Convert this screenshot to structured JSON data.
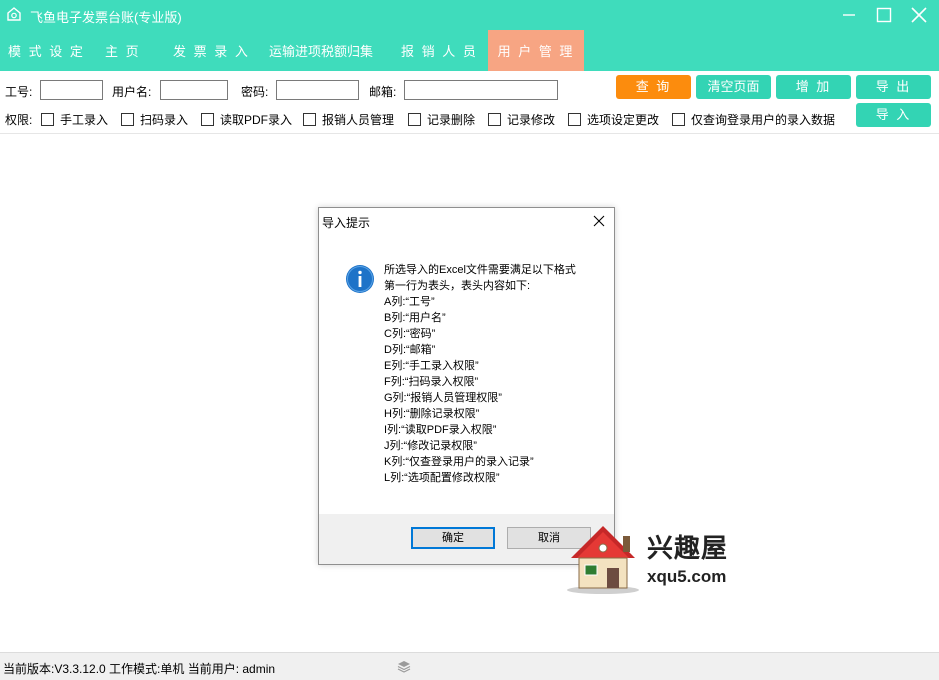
{
  "app": {
    "title": "飞鱼电子发票台账(专业版)"
  },
  "menu": [
    {
      "label": "模 式 设 定"
    },
    {
      "label": "主 页"
    },
    {
      "label": "发 票 录 入"
    },
    {
      "label": "运输进项税额归集"
    },
    {
      "label": "报 销 人 员"
    },
    {
      "label": "用 户 管 理",
      "active": true
    }
  ],
  "form": {
    "employee_id_label": "工号:",
    "employee_id_value": "",
    "username_label": "用户名:",
    "username_value": "",
    "password_label": "密码:",
    "password_value": "",
    "email_label": "邮箱:",
    "email_value": ""
  },
  "toolbar": {
    "query": "查 询",
    "clear": "清空页面",
    "add": "增 加",
    "export": "导 出",
    "import": "导 入"
  },
  "permissions": {
    "label": "权限:",
    "items": [
      {
        "label": "手工录入",
        "checked": false
      },
      {
        "label": "扫码录入",
        "checked": false
      },
      {
        "label": "读取PDF录入",
        "checked": false
      },
      {
        "label": "报销人员管理",
        "checked": false
      },
      {
        "label": "记录删除",
        "checked": false
      },
      {
        "label": "记录修改",
        "checked": false
      },
      {
        "label": "选项设定更改",
        "checked": false
      },
      {
        "label": "仅查询登录用户的录入数据",
        "checked": false
      }
    ]
  },
  "dialog": {
    "title": "导入提示",
    "lines": [
      "所选导入的Excel文件需要满足以下格式",
      "第一行为表头，表头内容如下:",
      "A列:“工号”",
      "B列:“用户名”",
      "C列:“密码”",
      "D列:“邮箱”",
      "E列:“手工录入权限”",
      "F列:“扫码录入权限”",
      "G列:“报销人员管理权限”",
      "H列:“删除记录权限”",
      "I列:“读取PDF录入权限”",
      "J列:“修改记录权限”",
      "K列:“仅查登录用户的录入记录”",
      "L列:“选项配置修改权限”"
    ],
    "ok": "确定",
    "cancel": "取消"
  },
  "watermark": {
    "name": "兴趣屋",
    "url": "xqu5.com"
  },
  "status": {
    "text": "当前版本:V3.3.12.0   工作模式:单机   当前用户:  admin"
  },
  "colors": {
    "accent": "#3fdcbc",
    "active_tab": "#f7a583",
    "query_button": "#fc8c0d",
    "button": "#33d4b4"
  }
}
